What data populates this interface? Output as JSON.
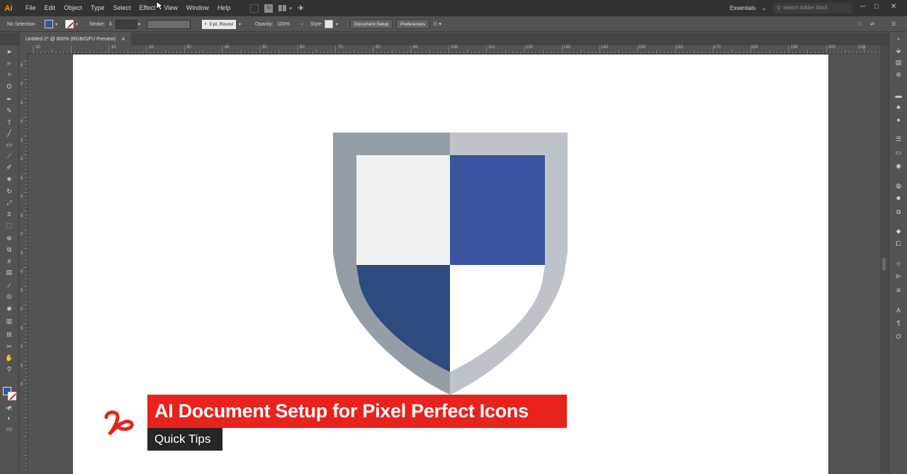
{
  "menubar": {
    "logo": "Ai",
    "items": [
      "File",
      "Edit",
      "Object",
      "Type",
      "Select",
      "Effect",
      "View",
      "Window",
      "Help"
    ],
    "workspace": "Essentials",
    "search_placeholder": "Search Adobe Stock",
    "minimize": "─",
    "maximize": "□",
    "close": "✕"
  },
  "controlbar": {
    "selection": "No Selection",
    "stroke_label": "Stroke:",
    "brush": "3 pt. Round",
    "opacity_label": "Opacity:",
    "opacity_value": "100%",
    "style_label": "Style:",
    "document_setup": "Document Setup",
    "preferences": "Preferences",
    "fill_color": "#3a55a0"
  },
  "tab": {
    "title": "Untitled-2* @ 800% (RGB/GPU Preview)",
    "close": "×"
  },
  "ruler": {
    "top": [
      "10",
      "10",
      "20",
      "30",
      "40",
      "50",
      "60",
      "70",
      "80",
      "90",
      "100",
      "110",
      "120",
      "130",
      "140",
      "150",
      "160",
      "170",
      "180",
      "190",
      "200",
      "210"
    ],
    "left": [
      "5",
      "0",
      "5",
      "0",
      "5",
      "0",
      "5",
      "0",
      "5",
      "0",
      "5",
      "0",
      "5",
      "0",
      "5",
      "0",
      "5",
      "0"
    ]
  },
  "shield": {
    "colors": {
      "outer_left": "#959ea6",
      "outer_right": "#bdc3c8",
      "top_left": "#f0f1f2",
      "top_right": "#3a55a0",
      "bottom_left": "#2c4b7e",
      "bottom_right": "#ffffff"
    }
  },
  "overlay": {
    "title": "AI Document Setup for Pixel Perfect Icons",
    "subtitle": "Quick Tips",
    "accent": "#e8221c"
  }
}
